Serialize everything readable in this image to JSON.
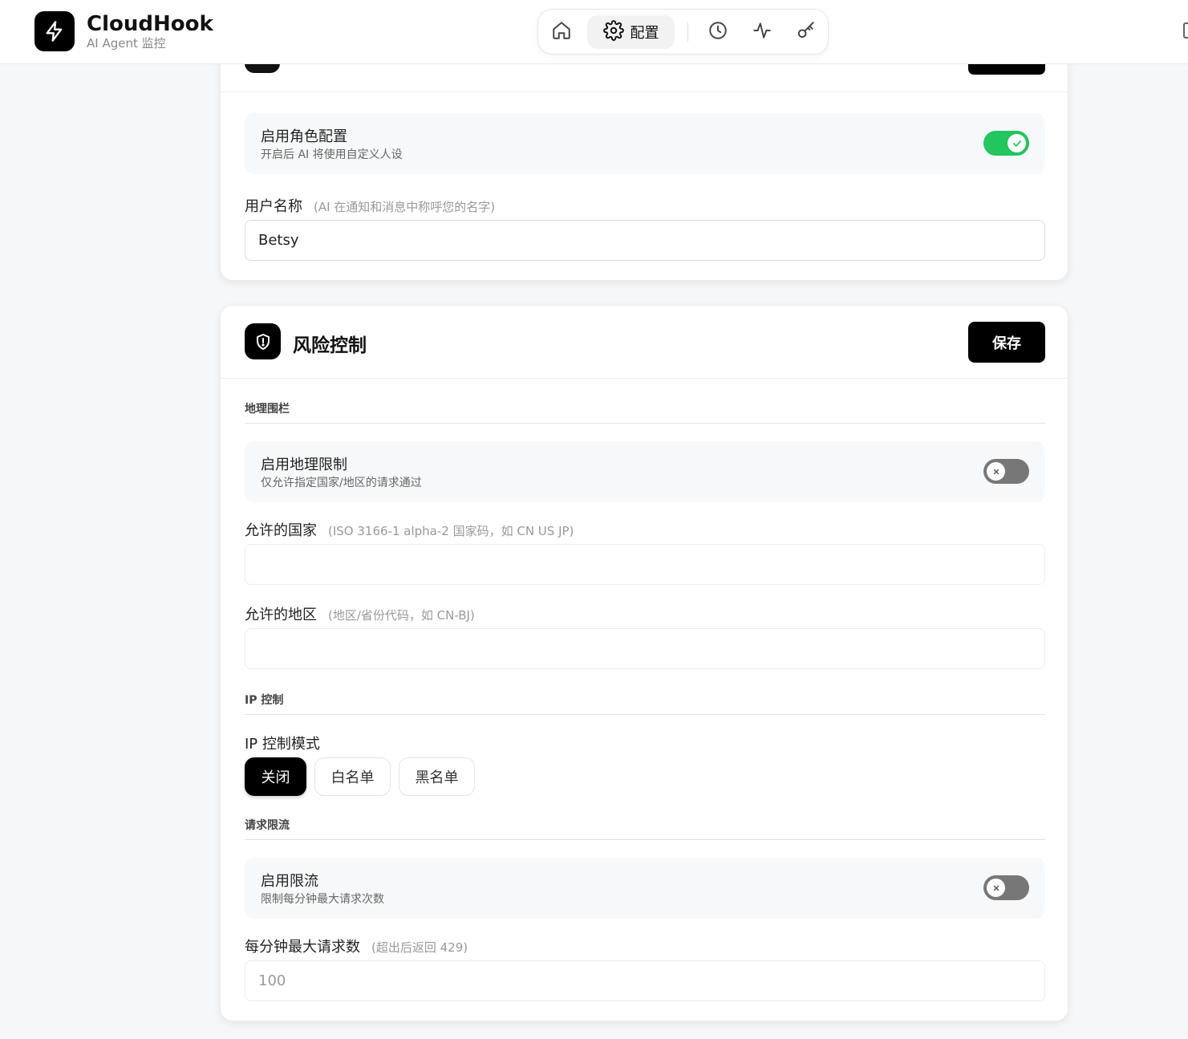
{
  "brand": {
    "name": "CloudHook",
    "subtitle": "AI Agent 监控"
  },
  "nav": {
    "items": [
      {
        "icon": "home-icon",
        "label": ""
      },
      {
        "icon": "gear-icon",
        "label": "配置",
        "active": true
      },
      {
        "icon": "clock-icon",
        "label": ""
      },
      {
        "icon": "activity-icon",
        "label": ""
      },
      {
        "icon": "key-icon",
        "label": ""
      }
    ]
  },
  "persona": {
    "toggle": {
      "title": "启用角色配置",
      "description": "开启后 AI 将使用自定义人设",
      "enabled": true
    },
    "username": {
      "label": "用户名称",
      "hint": "(AI 在通知和消息中称呼您的名字)",
      "value": "Betsy"
    }
  },
  "risk": {
    "title": "风险控制",
    "save_label": "保存",
    "geo": {
      "section": "地理围栏",
      "toggle": {
        "title": "启用地理限制",
        "description": "仅允许指定国家/地区的请求通过",
        "enabled": false
      },
      "countries": {
        "label": "允许的国家",
        "hint": "(ISO 3166-1 alpha-2 国家码，如 CN US JP)",
        "value": ""
      },
      "regions": {
        "label": "允许的地区",
        "hint": "(地区/省份代码，如 CN-BJ)",
        "value": ""
      }
    },
    "ip": {
      "section": "IP 控制",
      "mode_label": "IP 控制模式",
      "modes": [
        "关闭",
        "白名单",
        "黑名单"
      ],
      "selected": "关闭"
    },
    "rate": {
      "section": "请求限流",
      "toggle": {
        "title": "启用限流",
        "description": "限制每分钟最大请求次数",
        "enabled": false
      },
      "max": {
        "label": "每分钟最大请求数",
        "hint": "(超出后返回 429)",
        "placeholder": "100"
      }
    }
  },
  "colors": {
    "accent": "#000000",
    "toggle_on": "#22c55e",
    "toggle_off": "#777777"
  }
}
